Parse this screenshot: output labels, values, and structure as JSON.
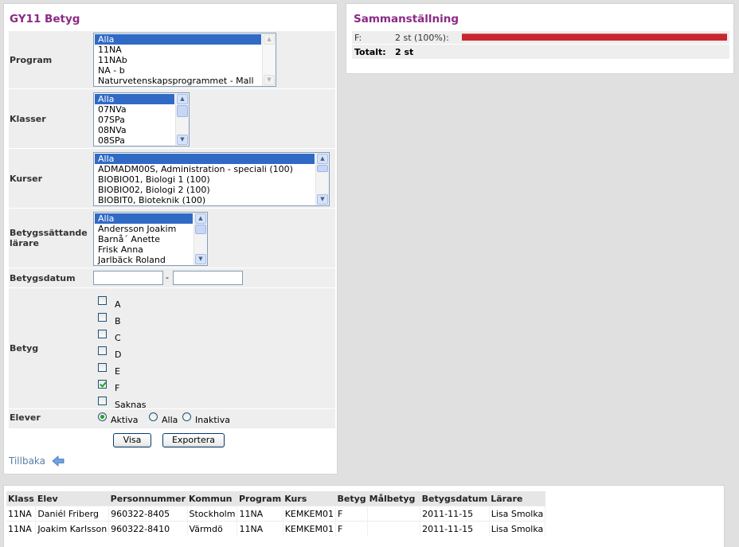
{
  "filter": {
    "title": "GY11 Betyg",
    "program": {
      "label": "Program",
      "options": [
        "Alla",
        "11NA",
        "11NAb",
        "NA - b",
        "Naturvetenskapsprogrammet - Mall"
      ],
      "selected": "Alla"
    },
    "klasser": {
      "label": "Klasser",
      "options": [
        "Alla",
        "07NVa",
        "07SPa",
        "08NVa",
        "08SPa"
      ],
      "selected": "Alla"
    },
    "kurser": {
      "label": "Kurser",
      "options": [
        "Alla",
        "ADMADM00S, Administration - speciali (100)",
        "BIOBIO01, Biologi 1 (100)",
        "BIOBIO02, Biologi 2 (100)",
        "BIOBIT0, Bioteknik (100)"
      ],
      "selected": "Alla"
    },
    "larare": {
      "label": "Betygssättande lärare",
      "options": [
        "Alla",
        "Andersson Joakim",
        "Barnå´ Anette",
        "Frisk Anna",
        "Jarlbäck Roland"
      ],
      "selected": "Alla"
    },
    "betygsdatum": {
      "label": "Betygsdatum",
      "separator": "-",
      "from_value": "",
      "to_value": ""
    },
    "betyg": {
      "label": "Betyg",
      "options": [
        {
          "label": "A",
          "checked": false
        },
        {
          "label": "B",
          "checked": false
        },
        {
          "label": "C",
          "checked": false
        },
        {
          "label": "D",
          "checked": false
        },
        {
          "label": "E",
          "checked": false
        },
        {
          "label": "F",
          "checked": true
        },
        {
          "label": "Saknas",
          "checked": false
        }
      ]
    },
    "elever": {
      "label": "Elever",
      "options": [
        {
          "label": "Aktiva",
          "checked": true
        },
        {
          "label": "Alla",
          "checked": false
        },
        {
          "label": "Inaktiva",
          "checked": false
        }
      ]
    },
    "buttons": {
      "visa": "Visa",
      "exportera": "Exportera"
    },
    "back_link": "Tillbaka",
    "back_icon": "arrow-left-icon"
  },
  "summary": {
    "title": "Sammanställning",
    "rows": [
      {
        "label": "F:",
        "value": "2 st (100%):",
        "bar_fraction": 1.0,
        "bar_color": "#c8282d"
      }
    ],
    "total_label": "Totalt:",
    "total_value": "2 st"
  },
  "results": {
    "columns": [
      "Klass",
      "Elev",
      "Personnummer",
      "Kommun",
      "Program",
      "Kurs",
      "Betyg",
      "Målbetyg",
      "Betygsdatum",
      "Lärare"
    ],
    "rows": [
      [
        "11NA",
        "Daniél Friberg",
        "960322-8405",
        "Stockholm",
        "11NA",
        "KEMKEM01",
        "F",
        "",
        "2011-11-15",
        "Lisa Smolka"
      ],
      [
        "11NA",
        "Joakim Karlsson",
        "960322-8410",
        "Värmdö",
        "11NA",
        "KEMKEM01",
        "F",
        "",
        "2011-11-15",
        "Lisa Smolka"
      ]
    ]
  },
  "colors": {
    "title": "#8b2a86",
    "selection": "#316ac5",
    "link": "#5a7fa8",
    "bar": "#c8282d"
  }
}
